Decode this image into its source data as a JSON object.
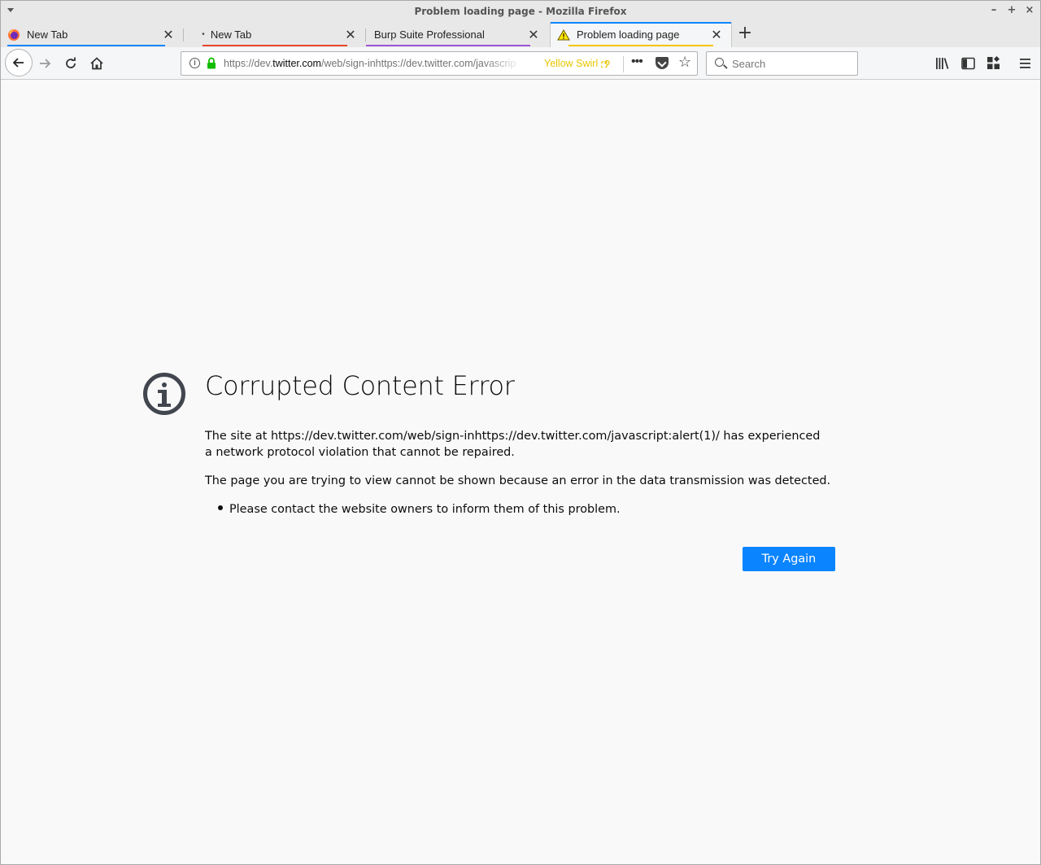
{
  "window": {
    "title": "Problem loading page - Mozilla Firefox",
    "controls": {
      "minimize": "–",
      "maximize": "+",
      "close": "×"
    }
  },
  "tabs": [
    {
      "label": "New Tab",
      "accent": "#0a84ff",
      "icon": "firefox-icon"
    },
    {
      "label": "New Tab",
      "accent": "#e8452c",
      "icon": "dot-icon"
    },
    {
      "label": "Burp Suite Professional",
      "accent": "#9d54d6",
      "icon": ""
    },
    {
      "label": "Problem loading page",
      "accent": "#f3c500",
      "icon": "warning-icon",
      "active": true
    }
  ],
  "navbar": {
    "url_prefix": "https://dev.",
    "url_domain": "twitter.com",
    "url_rest": "/web/sign-inhttps://dev.twitter.com/javascript:alert(1)/",
    "container_label": "Yellow Swirl",
    "container_color": "#e8c500",
    "search_placeholder": "Search"
  },
  "error": {
    "title": "Corrupted Content Error",
    "description": "The site at https://dev.twitter.com/web/sign-inhttps://dev.twitter.com/javascript:alert(1)/ has experienced a network protocol violation that cannot be repaired.",
    "detail": "The page you are trying to view cannot be shown because an error in the data transmission was detected.",
    "suggestions": [
      "Please contact the website owners to inform them of this problem."
    ],
    "try_again_label": "Try Again",
    "accent": "#0a84ff"
  }
}
